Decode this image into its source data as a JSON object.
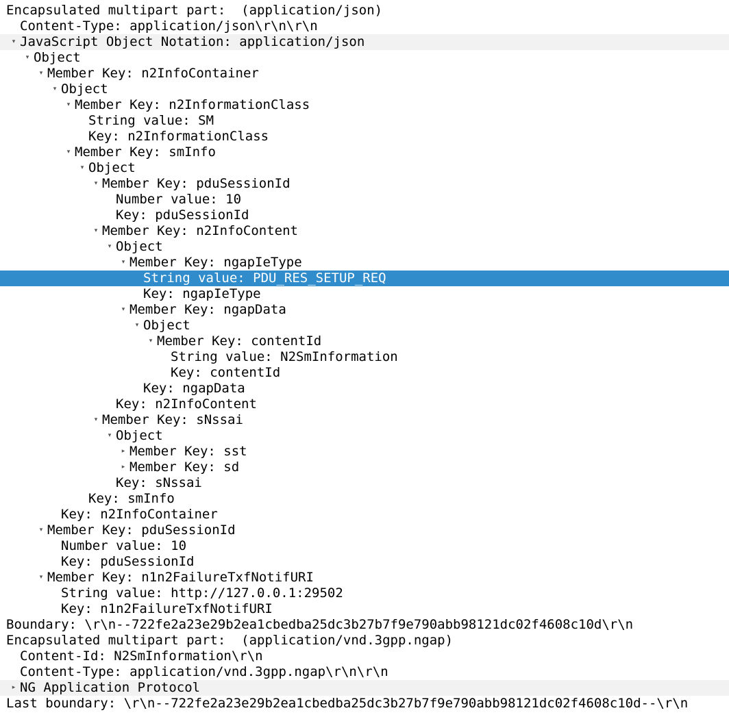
{
  "tree": [
    {
      "text": "Encapsulated multipart part:  (application/json)",
      "depth": 0,
      "toggle": "none",
      "state": "normal"
    },
    {
      "text": "Content-Type: application/json\\r\\n\\r\\n",
      "depth": 1,
      "toggle": "none",
      "state": "normal"
    },
    {
      "text": "JavaScript Object Notation: application/json",
      "depth": 1,
      "toggle": "expanded",
      "state": "band"
    },
    {
      "text": "Object",
      "depth": 2,
      "toggle": "expanded",
      "state": "normal"
    },
    {
      "text": "Member Key: n2InfoContainer",
      "depth": 3,
      "toggle": "expanded",
      "state": "normal"
    },
    {
      "text": "Object",
      "depth": 4,
      "toggle": "expanded",
      "state": "normal"
    },
    {
      "text": "Member Key: n2InformationClass",
      "depth": 5,
      "toggle": "expanded",
      "state": "normal"
    },
    {
      "text": "String value: SM",
      "depth": 6,
      "toggle": "none",
      "state": "normal"
    },
    {
      "text": "Key: n2InformationClass",
      "depth": 6,
      "toggle": "none",
      "state": "normal"
    },
    {
      "text": "Member Key: smInfo",
      "depth": 5,
      "toggle": "expanded",
      "state": "normal"
    },
    {
      "text": "Object",
      "depth": 6,
      "toggle": "expanded",
      "state": "normal"
    },
    {
      "text": "Member Key: pduSessionId",
      "depth": 7,
      "toggle": "expanded",
      "state": "normal"
    },
    {
      "text": "Number value: 10",
      "depth": 8,
      "toggle": "none",
      "state": "normal"
    },
    {
      "text": "Key: pduSessionId",
      "depth": 8,
      "toggle": "none",
      "state": "normal"
    },
    {
      "text": "Member Key: n2InfoContent",
      "depth": 7,
      "toggle": "expanded",
      "state": "normal"
    },
    {
      "text": "Object",
      "depth": 8,
      "toggle": "expanded",
      "state": "normal"
    },
    {
      "text": "Member Key: ngapIeType",
      "depth": 9,
      "toggle": "expanded",
      "state": "normal"
    },
    {
      "text": "String value: PDU_RES_SETUP_REQ",
      "depth": 10,
      "toggle": "none",
      "state": "selected"
    },
    {
      "text": "Key: ngapIeType",
      "depth": 10,
      "toggle": "none",
      "state": "normal"
    },
    {
      "text": "Member Key: ngapData",
      "depth": 9,
      "toggle": "expanded",
      "state": "normal"
    },
    {
      "text": "Object",
      "depth": 10,
      "toggle": "expanded",
      "state": "normal"
    },
    {
      "text": "Member Key: contentId",
      "depth": 11,
      "toggle": "expanded",
      "state": "normal"
    },
    {
      "text": "String value: N2SmInformation",
      "depth": 12,
      "toggle": "none",
      "state": "normal"
    },
    {
      "text": "Key: contentId",
      "depth": 12,
      "toggle": "none",
      "state": "normal"
    },
    {
      "text": "Key: ngapData",
      "depth": 10,
      "toggle": "none",
      "state": "normal"
    },
    {
      "text": "Key: n2InfoContent",
      "depth": 8,
      "toggle": "none",
      "state": "normal"
    },
    {
      "text": "Member Key: sNssai",
      "depth": 7,
      "toggle": "expanded",
      "state": "normal"
    },
    {
      "text": "Object",
      "depth": 8,
      "toggle": "expanded",
      "state": "normal"
    },
    {
      "text": "Member Key: sst",
      "depth": 9,
      "toggle": "collapsed",
      "state": "normal"
    },
    {
      "text": "Member Key: sd",
      "depth": 9,
      "toggle": "collapsed",
      "state": "normal"
    },
    {
      "text": "Key: sNssai",
      "depth": 8,
      "toggle": "none",
      "state": "normal"
    },
    {
      "text": "Key: smInfo",
      "depth": 6,
      "toggle": "none",
      "state": "normal"
    },
    {
      "text": "Key: n2InfoContainer",
      "depth": 4,
      "toggle": "none",
      "state": "normal"
    },
    {
      "text": "Member Key: pduSessionId",
      "depth": 3,
      "toggle": "expanded",
      "state": "normal"
    },
    {
      "text": "Number value: 10",
      "depth": 4,
      "toggle": "none",
      "state": "normal"
    },
    {
      "text": "Key: pduSessionId",
      "depth": 4,
      "toggle": "none",
      "state": "normal"
    },
    {
      "text": "Member Key: n1n2FailureTxfNotifURI",
      "depth": 3,
      "toggle": "expanded",
      "state": "normal"
    },
    {
      "text": "String value: http://127.0.0.1:29502",
      "depth": 4,
      "toggle": "none",
      "state": "normal"
    },
    {
      "text": "Key: n1n2FailureTxfNotifURI",
      "depth": 4,
      "toggle": "none",
      "state": "normal"
    },
    {
      "text": "Boundary: \\r\\n--722fe2a23e29b2ea1cbedba25dc3b27b7f9e790abb98121dc02f4608c10d\\r\\n",
      "depth": 0,
      "toggle": "none",
      "state": "normal"
    },
    {
      "text": "Encapsulated multipart part:  (application/vnd.3gpp.ngap)",
      "depth": 0,
      "toggle": "none",
      "state": "normal"
    },
    {
      "text": "Content-Id: N2SmInformation\\r\\n",
      "depth": 1,
      "toggle": "none",
      "state": "normal"
    },
    {
      "text": "Content-Type: application/vnd.3gpp.ngap\\r\\n\\r\\n",
      "depth": 1,
      "toggle": "none",
      "state": "normal"
    },
    {
      "text": "NG Application Protocol",
      "depth": 1,
      "toggle": "collapsed",
      "state": "band"
    },
    {
      "text": "Last boundary: \\r\\n--722fe2a23e29b2ea1cbedba25dc3b27b7f9e790abb98121dc02f4608c10d--\\r\\n",
      "depth": 0,
      "toggle": "none",
      "state": "normal"
    }
  ],
  "icons": {
    "expanded": "triangle-down-icon",
    "collapsed": "triangle-right-icon"
  },
  "colors": {
    "selection": "#308ccb",
    "band": "#f2f2f2"
  }
}
